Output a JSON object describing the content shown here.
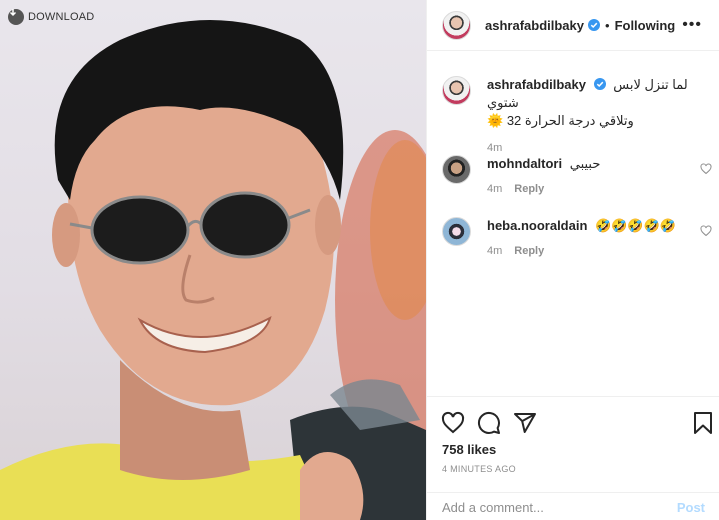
{
  "photo": {
    "download_label": "DOWNLOAD",
    "alt_subject": "portrait-photo"
  },
  "header": {
    "username": "ashrafabdilbaky",
    "separator": "•",
    "follow_status": "Following",
    "more_icon": "more-horizontal-icon"
  },
  "caption": {
    "username": "ashrafabdilbaky",
    "text_line1": "لما تنزل لابس شتوي",
    "text_line2": "وتلاقي درجة الحرارة 32 🌞",
    "time": "4m"
  },
  "comments": [
    {
      "username": "mohndaltori",
      "text": "حبيبي",
      "time": "4m",
      "reply_label": "Reply"
    },
    {
      "username": "heba.nooraldain",
      "text": "🤣🤣🤣🤣🤣",
      "time": "4m",
      "reply_label": "Reply"
    }
  ],
  "actions": {
    "like_icon": "heart-icon",
    "comment_icon": "comment-icon",
    "share_icon": "send-icon",
    "save_icon": "bookmark-icon",
    "likes": "758 likes",
    "time_ago": "4 MINUTES AGO"
  },
  "add_comment": {
    "placeholder": "Add a comment...",
    "post_label": "Post"
  },
  "colors": {
    "verified": "#3897f0",
    "post_disabled": "#b3dbff",
    "meta": "#8e8e8e"
  }
}
